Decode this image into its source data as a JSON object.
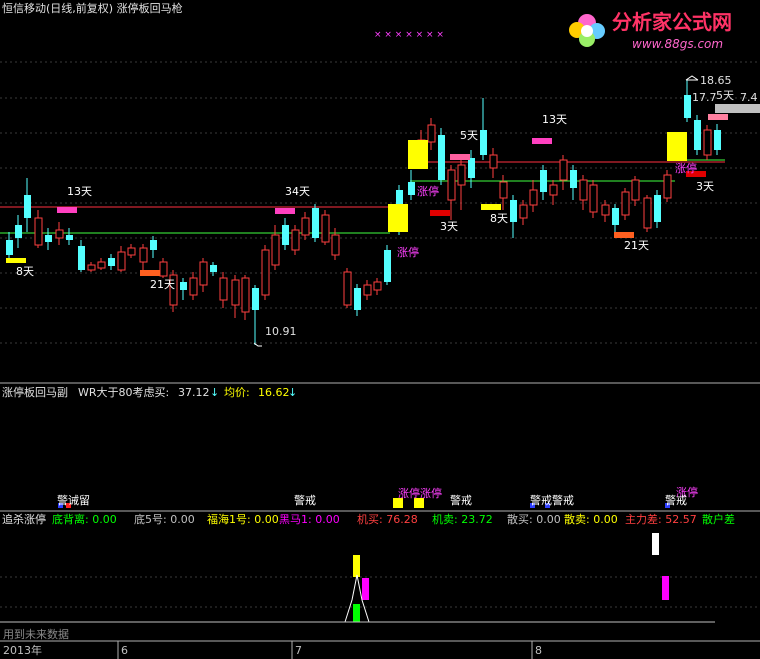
{
  "header": {
    "title": "恒信移动(日线,前复权) 涨停板回马枪"
  },
  "logo": {
    "name": "分析家公式网",
    "url": "www.88gs.com"
  },
  "main_chart": {
    "price_high_label": "18.65",
    "price_low_label": "10.91",
    "price_label_2": "17.7",
    "price_label_2b": "5天",
    "price_label_3": "7.4",
    "day_labels": [
      "13天",
      "8天",
      "21天",
      "34天",
      "3天",
      "5天",
      "13天",
      "8天",
      "21天",
      "3天",
      "5天"
    ],
    "zhangting_labels": [
      "涨停",
      "涨停",
      "涨停"
    ],
    "x_marks": "×   × × × × ×   ×"
  },
  "indicator1": {
    "name": "涨停板回马副",
    "wr_label": "WR大于80考虑买:",
    "wr_value": "37.12",
    "avg_label": "均价:",
    "avg_value": "16.62",
    "signals": [
      "警诫留",
      "警戒",
      "涨停涨停",
      "警戒",
      "警戒",
      "警戒",
      "涨停"
    ]
  },
  "indicator2": {
    "name": "追杀涨停",
    "fields": [
      {
        "label": "底背离:",
        "value": "0.00",
        "color": "#00ff00"
      },
      {
        "label": "底5号:",
        "value": "0.00",
        "color": "#c0c0c0"
      },
      {
        "label": "福海1号:",
        "value": "0.00",
        "color": "#ffff00"
      },
      {
        "label": "黑马1:",
        "value": "0.00",
        "color": "#ff00ff"
      },
      {
        "label": "机买:",
        "value": "76.28",
        "color": "#ff4040"
      },
      {
        "label": "机卖:",
        "value": "23.72",
        "color": "#00ff00"
      },
      {
        "label": "散买:",
        "value": "0.00",
        "color": "#c0c0c0"
      },
      {
        "label": "散卖:",
        "value": "0.00",
        "color": "#ffff00"
      },
      {
        "label": "主力差:",
        "value": "52.57",
        "color": "#ff4040"
      },
      {
        "label": "散户差",
        "value": "",
        "color": "#00ff00"
      }
    ],
    "footer_note": "用到未来数据"
  },
  "time_axis": {
    "labels": [
      "2013年",
      "6",
      "7",
      "8"
    ]
  },
  "colors": {
    "up": "#ff4040",
    "down": "#54ffff",
    "yellow": "#ffff00",
    "magenta": "#ff00ff",
    "grid": "#303030"
  }
}
